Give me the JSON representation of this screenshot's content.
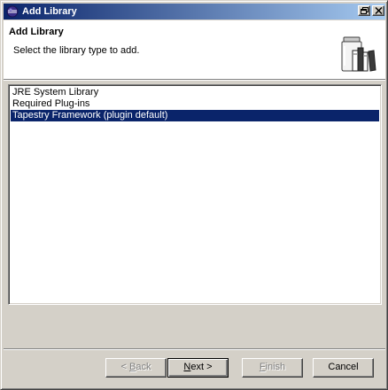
{
  "window": {
    "title": "Add Library",
    "title_bar_gradient": [
      "#0a246a",
      "#a6caf0"
    ],
    "icons": {
      "app": "eclipse-icon",
      "maximize": "maximize-icon",
      "close": "close-icon"
    }
  },
  "header": {
    "title": "Add Library",
    "description": "Select the library type to add.",
    "image": "library-books-icon"
  },
  "library_types": {
    "items": [
      {
        "label": "JRE System Library",
        "selected": false
      },
      {
        "label": "Required Plug-ins",
        "selected": false
      },
      {
        "label": "Tapestry Framework (plugin default)",
        "selected": true
      }
    ],
    "selection_color": "#0a246a"
  },
  "buttons": {
    "back": {
      "arrow": "<",
      "mnemonic": "B",
      "rest": "ack",
      "enabled": false
    },
    "next": {
      "mnemonic": "N",
      "rest": "ext",
      "arrow": ">",
      "enabled": true,
      "default": true
    },
    "finish": {
      "mnemonic": "F",
      "rest": "inish",
      "enabled": false
    },
    "cancel": {
      "label": "Cancel",
      "enabled": true
    }
  }
}
